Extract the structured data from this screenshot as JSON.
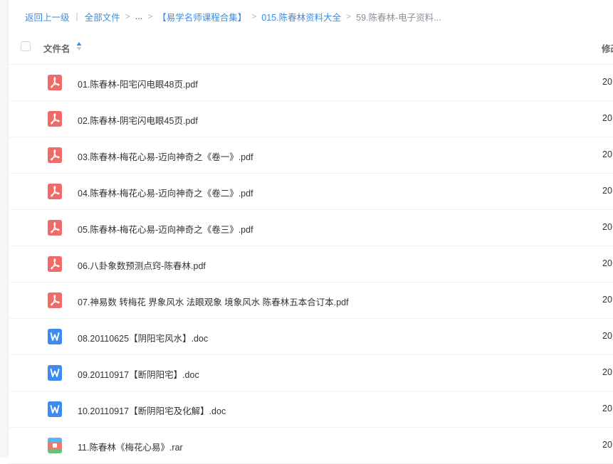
{
  "breadcrumb": {
    "back": "返回上一级",
    "all_files": "全部文件",
    "ellipsis": "...",
    "folder1": "【易学名师课程合集】",
    "folder2": "015.陈春林资料大全",
    "current": "59.陈春林-电子资料..."
  },
  "table": {
    "col_name": "文件名",
    "col_modified": "修改"
  },
  "files": [
    {
      "name": "01.陈春林-阳宅闪电眼48页.pdf",
      "type": "pdf-icon",
      "date": "20"
    },
    {
      "name": "02.陈春林-阴宅闪电眼45页.pdf",
      "type": "pdf-icon",
      "date": "20"
    },
    {
      "name": "03.陈春林-梅花心易-迈向神奇之《卷一》.pdf",
      "type": "pdf-icon",
      "date": "20"
    },
    {
      "name": "04.陈春林-梅花心易-迈向神奇之《卷二》.pdf",
      "type": "pdf-icon",
      "date": "20"
    },
    {
      "name": "05.陈春林-梅花心易-迈向神奇之《卷三》.pdf",
      "type": "pdf-icon",
      "date": "20"
    },
    {
      "name": "06.八卦象数预测点窍-陈春林.pdf",
      "type": "pdf-icon",
      "date": "20"
    },
    {
      "name": "07.神易数 转梅花 界象风水 法眼观象 境象风水 陈春林五本合订本.pdf",
      "type": "pdf-icon",
      "date": "20"
    },
    {
      "name": "08.20110625【阴阳宅风水】.doc",
      "type": "word-icon",
      "date": "20"
    },
    {
      "name": "09.20110917【断阴阳宅】.doc",
      "type": "word-icon",
      "date": "20"
    },
    {
      "name": "10.20110917【断阴阳宅及化解】.doc",
      "type": "word-icon",
      "date": "20"
    },
    {
      "name": "11.陈春林《梅花心易》.rar",
      "type": "archive-icon",
      "date": "20"
    }
  ],
  "colors": {
    "link": "#3a8ee6",
    "pdf": "#f16a6a",
    "word": "#3d8bf2"
  }
}
